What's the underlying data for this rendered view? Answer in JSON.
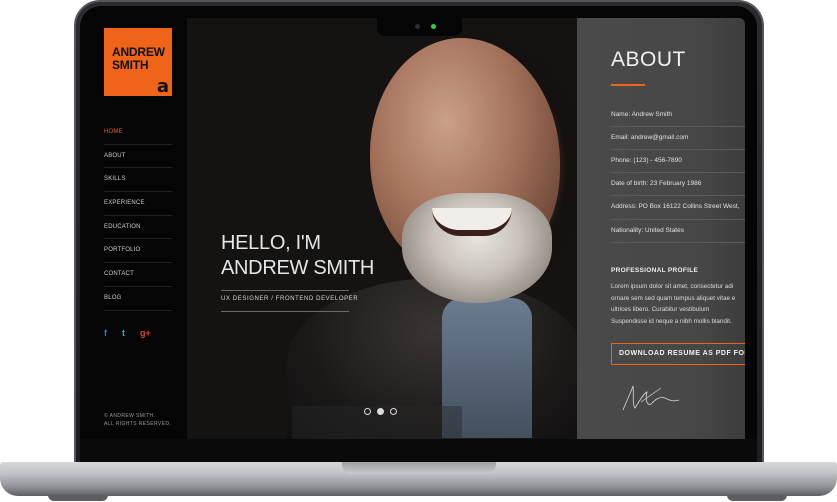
{
  "sidebar": {
    "logo": {
      "line1": "ANDREW",
      "line2": "SMITH",
      "letter": "a"
    },
    "nav": [
      "HOME",
      "ABOUT",
      "SKILLS",
      "EXPERIENCE",
      "EDUCATION",
      "PORTFOLIO",
      "CONTACT",
      "BLOG"
    ],
    "social": {
      "facebook": "f",
      "twitter": "t",
      "google": "g+"
    },
    "copyright_line1": "© ANDREW SMITH.",
    "copyright_line2": "ALL RIGHTS RESERVED."
  },
  "hero": {
    "greeting": "HELLO, I'M",
    "name": "ANDREW SMITH",
    "subtitle": "UX DESIGNER / FRONTEND DEVELOPER"
  },
  "about": {
    "title": "ABOUT",
    "info": [
      "Name: Andrew Smith",
      "Email: andrew@gmail.com",
      "Phone: (123) - 456-7890",
      "Date of birth: 23 February 1986",
      "Address: PO Box 16122 Collins Street West,",
      "Nationality: United States"
    ],
    "profile_title": "PROFESSIONAL PROFILE",
    "profile_lines": [
      "Lorem ipsum dolor sit amet, consectetur adi",
      "ornare sem sed quam tempus aliquet vitae e",
      "ultrices libero. Curabitur vestibulum",
      "Suspendisse id neque a nibh mollis blandit."
    ],
    "download_label": "DOWNLOAD RESUME AS PDF FORMAT"
  },
  "colors": {
    "accent": "#ef6418",
    "sidebar": "#050505",
    "panel": "#4a4a4a"
  }
}
